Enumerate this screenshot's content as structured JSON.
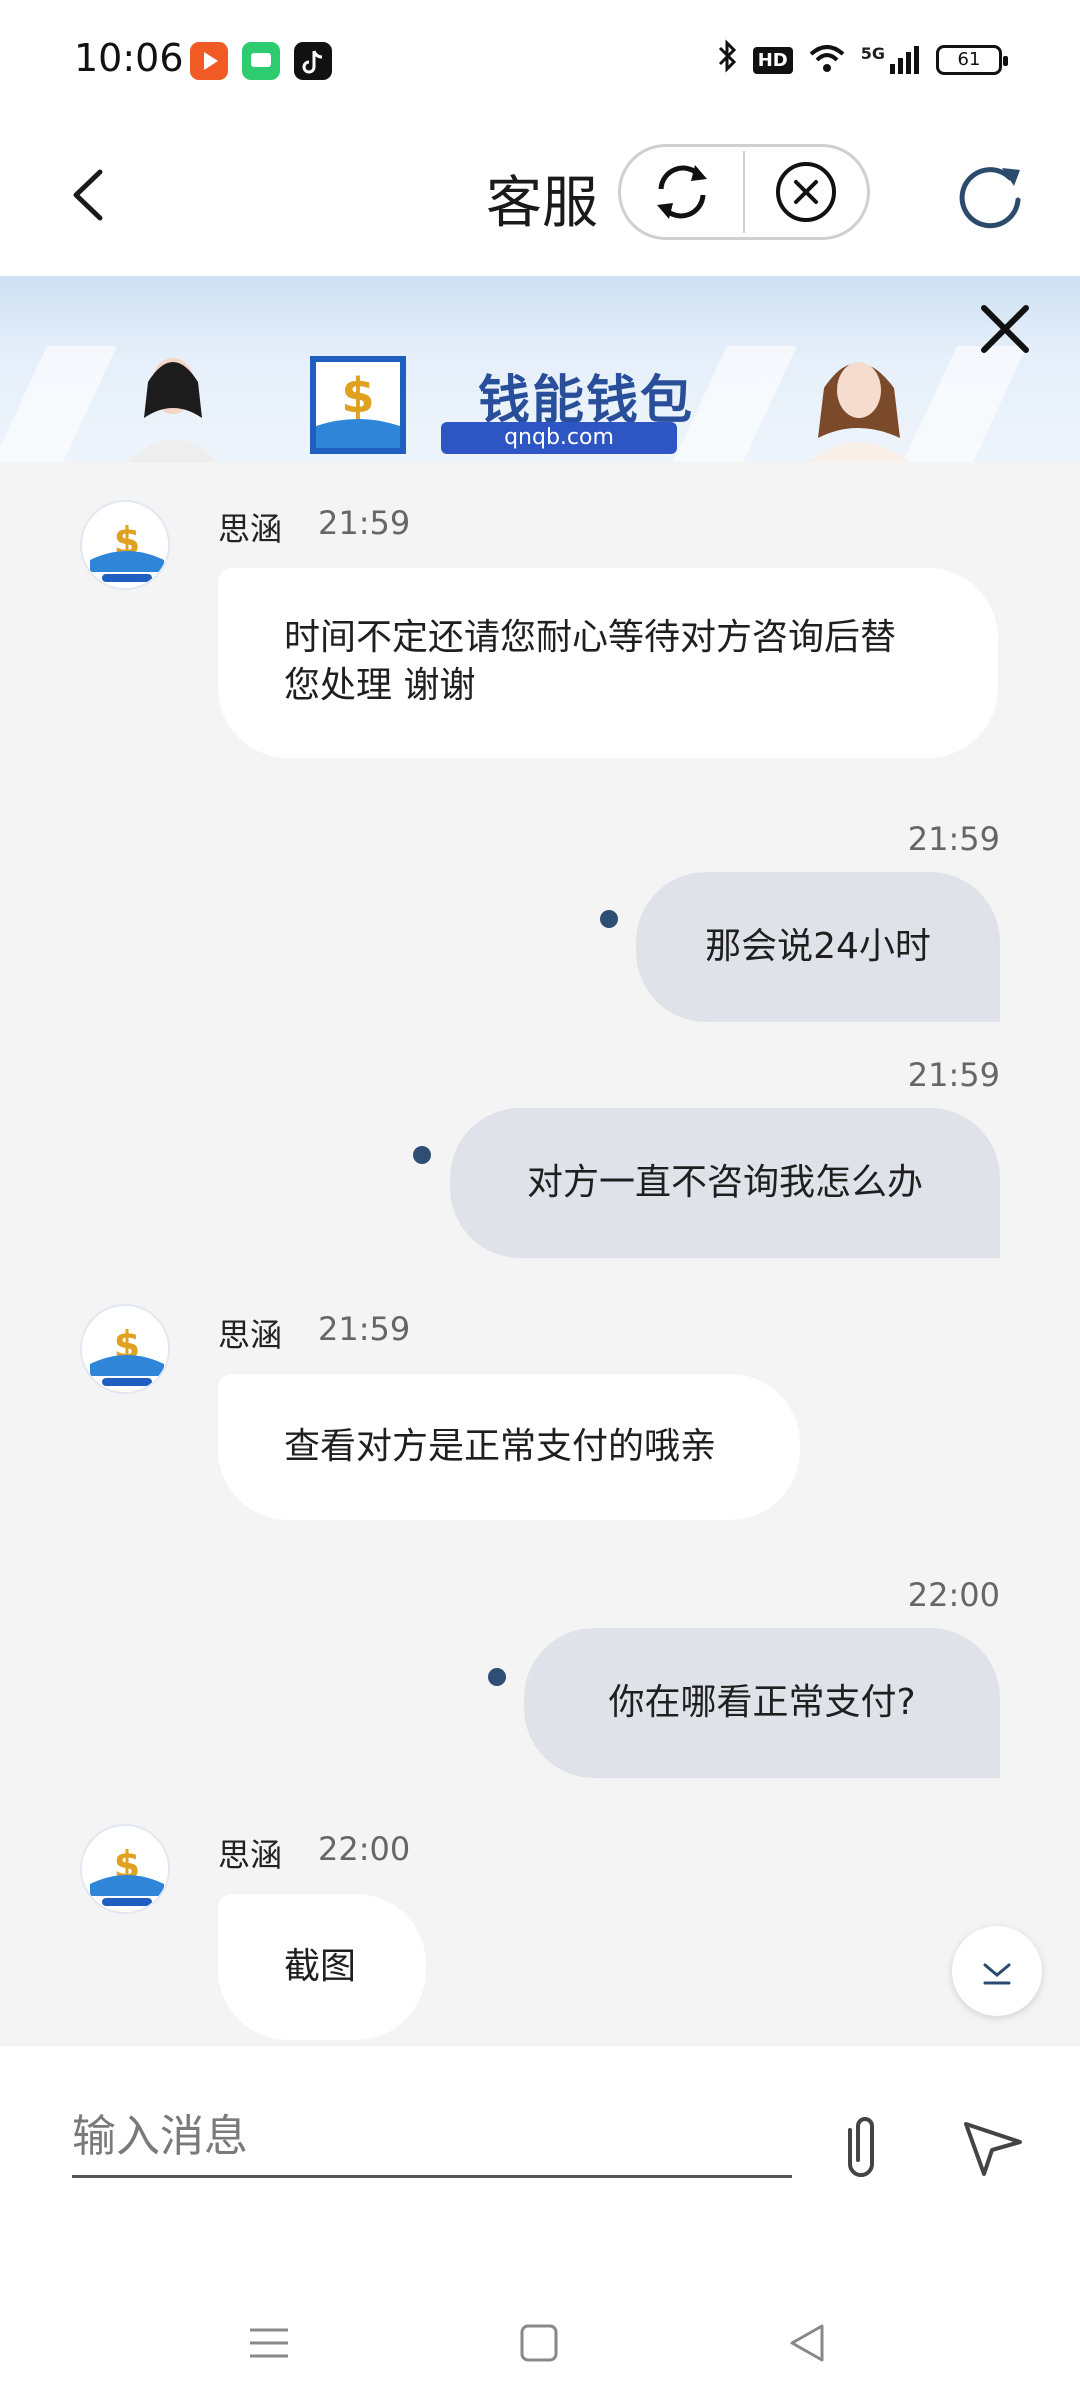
{
  "status_bar": {
    "time": "10:06",
    "battery": "61",
    "network": "5G",
    "hd": "HD"
  },
  "header": {
    "title": "客服"
  },
  "banner": {
    "brand": "钱能钱包",
    "url": "qnqb.com"
  },
  "messages": [
    {
      "direction": "in",
      "sender": "思涵",
      "time": "21:59",
      "text_line1": "时间不定还请您耐心等待对方咨询后替",
      "text_line2": "您处理 谢谢"
    },
    {
      "direction": "out",
      "time": "21:59",
      "text": "那会说24小时"
    },
    {
      "direction": "out",
      "time": "21:59",
      "text": "对方一直不咨询我怎么办"
    },
    {
      "direction": "in",
      "sender": "思涵",
      "time": "21:59",
      "text": "查看对方是正常支付的哦亲"
    },
    {
      "direction": "out",
      "time": "22:00",
      "text": "你在哪看正常支付?"
    },
    {
      "direction": "in",
      "sender": "思涵",
      "time": "22:00",
      "text": "截图"
    }
  ],
  "input": {
    "placeholder": "输入消息"
  },
  "colors": {
    "outgoing_bubble": "#dfe3e9",
    "incoming_bubble": "#ffffff",
    "chat_background": "#f4f4f4",
    "status_dot": "#2e4e74"
  }
}
